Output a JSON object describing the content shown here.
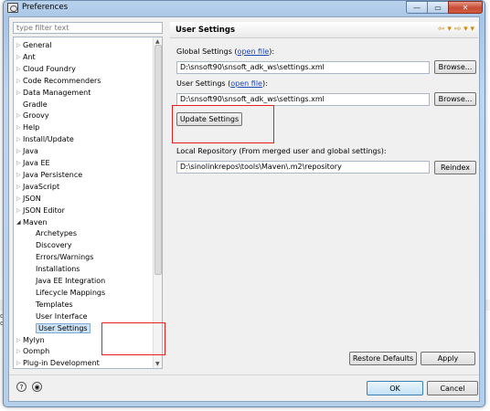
{
  "window": {
    "title": "Preferences",
    "minimize_glyph": "—",
    "maximize_glyph": "▭",
    "close_glyph": "✕"
  },
  "filter": {
    "placeholder": "type filter text"
  },
  "tree": {
    "items": [
      {
        "label": "General",
        "arrow": "▷"
      },
      {
        "label": "Ant",
        "arrow": "▷"
      },
      {
        "label": "Cloud Foundry",
        "arrow": "▷"
      },
      {
        "label": "Code Recommenders",
        "arrow": "▷"
      },
      {
        "label": "Data Management",
        "arrow": "▷"
      },
      {
        "label": "Gradle",
        "arrow": ""
      },
      {
        "label": "Groovy",
        "arrow": "▷"
      },
      {
        "label": "Help",
        "arrow": "▷"
      },
      {
        "label": "Install/Update",
        "arrow": "▷"
      },
      {
        "label": "Java",
        "arrow": "▷"
      },
      {
        "label": "Java EE",
        "arrow": "▷"
      },
      {
        "label": "Java Persistence",
        "arrow": "▷"
      },
      {
        "label": "JavaScript",
        "arrow": "▷"
      },
      {
        "label": "JSON",
        "arrow": "▷"
      },
      {
        "label": "JSON Editor",
        "arrow": "▷"
      },
      {
        "label": "Maven",
        "arrow": "◢"
      },
      {
        "label": "Archetypes",
        "arrow": ""
      },
      {
        "label": "Discovery",
        "arrow": ""
      },
      {
        "label": "Errors/Warnings",
        "arrow": ""
      },
      {
        "label": "Installations",
        "arrow": ""
      },
      {
        "label": "Java EE Integration",
        "arrow": ""
      },
      {
        "label": "Lifecycle Mappings",
        "arrow": ""
      },
      {
        "label": "Templates",
        "arrow": ""
      },
      {
        "label": "User Interface",
        "arrow": ""
      },
      {
        "label": "User Settings",
        "arrow": ""
      },
      {
        "label": "Mylyn",
        "arrow": "▷"
      },
      {
        "label": "Oomph",
        "arrow": "▷"
      },
      {
        "label": "Plug-in Development",
        "arrow": "▷"
      }
    ],
    "selected": "User Settings"
  },
  "page": {
    "title": "User Settings",
    "nav_icons": "⇦ ▾ ⇨ ▾ ▾",
    "global_label_prefix": "Global Settings (",
    "global_label_link": "open file",
    "global_label_suffix": "):",
    "global_path": "D:\\snsoft90\\snsoft_adk_ws\\settings.xml",
    "browse1": "Browse...",
    "user_label_prefix": "User Settings (",
    "user_label_link": "open file",
    "user_label_suffix": "):",
    "user_path": "D:\\snsoft90\\snsoft_adk_ws\\settings.xml",
    "browse2": "Browse...",
    "update_button": "Update Settings",
    "local_repo_label": "Local Repository (From merged user and global settings):",
    "local_repo_path": "D:\\sinolinkrepos\\tools\\Maven\\.m2\\repository",
    "reindex_button": "Reindex",
    "restore_button": "Restore Defaults",
    "apply_button": "Apply"
  },
  "footer": {
    "help_glyph": "?",
    "info_glyph": "◉",
    "ok": "OK",
    "cancel": "Cancel"
  },
  "background": {
    "text1": "d",
    "text2": "o"
  }
}
